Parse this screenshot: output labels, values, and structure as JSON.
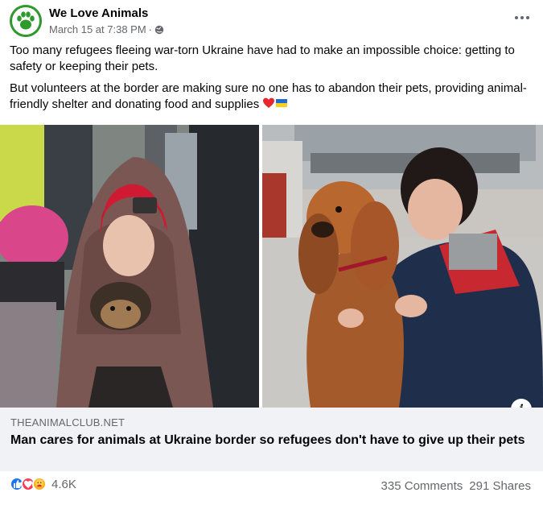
{
  "post": {
    "page_name": "We Love Animals",
    "timestamp": "March 15 at 7:38 PM",
    "separator": "·",
    "visibility_icon": "globe-icon",
    "more_icon": "more-options-icon",
    "paragraphs": [
      "Too many refugees fleeing war-torn Ukraine have had to make an impossible choice: getting to safety or keeping their pets.",
      "But volunteers at the border are making sure no one has to abandon their pets, providing animal-friendly shelter and donating food and supplies"
    ],
    "emojis": [
      "red-heart-icon",
      "ukraine-flag-icon"
    ]
  },
  "images": {
    "left": "girl-wrapped-in-blanket-holding-small-dog-photo",
    "right": "woman-hugging-cocker-spaniel-photo",
    "info_icon": "info-icon"
  },
  "link": {
    "domain": "THEANIMALCLUB.NET",
    "title": "Man cares for animals at Ukraine border so refugees don't have to give up their pets"
  },
  "footer": {
    "reactions": [
      "like-icon",
      "love-icon",
      "care-icon"
    ],
    "reaction_count": "4.6K",
    "comments": "335 Comments",
    "shares": "291 Shares"
  },
  "colors": {
    "like": "#1877f2",
    "love": "#f33e58",
    "care": "#f7b125",
    "secondary_text": "#65676b",
    "link_bg": "#f0f2f5",
    "avatar_bg": "#2e9a2e"
  }
}
